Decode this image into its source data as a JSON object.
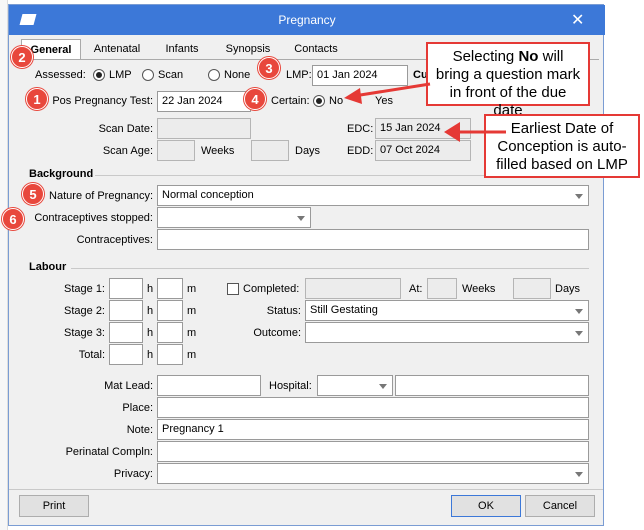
{
  "window": {
    "title": "Pregnancy"
  },
  "tabs": [
    "General",
    "Antenatal",
    "Infants",
    "Synopsis",
    "Contacts"
  ],
  "assessed": {
    "label": "Assessed:",
    "options": [
      "LMP",
      "Scan",
      "None"
    ],
    "selected": "LMP"
  },
  "lmp": {
    "label": "LMP:",
    "value": "01 Jan 2024",
    "cut_label": "Cu"
  },
  "pos_test": {
    "label": "Pos Pregnancy Test:",
    "value": "22 Jan 2024"
  },
  "certain": {
    "label": "Certain:",
    "options": [
      "No",
      "Yes"
    ],
    "selected": "No",
    "yes_fragment": "Yes"
  },
  "scan_date": {
    "label": "Scan Date:",
    "value": ""
  },
  "scan_age": {
    "label": "Scan Age:",
    "weeks_label": "Weeks",
    "days_label": "Days"
  },
  "edc": {
    "label": "EDC:",
    "value": "15 Jan 2024"
  },
  "edd": {
    "label": "EDD:",
    "value": "07 Oct 2024"
  },
  "background": {
    "heading": "Background",
    "nature_label": "Nature of Pregnancy:",
    "nature_value": "Normal conception",
    "contra_stopped_label": "Contraceptives stopped:",
    "contra_stopped_value": "",
    "contraceptives_label": "Contraceptives:",
    "contraceptives_value": ""
  },
  "labour": {
    "heading": "Labour",
    "stage1": "Stage 1:",
    "stage2": "Stage 2:",
    "stage3": "Stage 3:",
    "total": "Total:",
    "h": "h",
    "m": "m",
    "completed_label": "Completed:",
    "at_label": "At:",
    "weeks": "Weeks",
    "days": "Days",
    "status_label": "Status:",
    "status_value": "Still Gestating",
    "outcome_label": "Outcome:",
    "outcome_value": ""
  },
  "other": {
    "mat_lead_label": "Mat Lead:",
    "hospital_label": "Hospital:",
    "place_label": "Place:",
    "note_label": "Note:",
    "note_value": "Pregnancy 1",
    "perinatal_label": "Perinatal Compln:",
    "privacy_label": "Privacy:"
  },
  "buttons": {
    "print": "Print",
    "ok": "OK",
    "cancel": "Cancel"
  },
  "annotations": {
    "badges": [
      "1",
      "2",
      "3",
      "4",
      "5",
      "6"
    ],
    "callout1": "Selecting No will bring a question mark in front of the due date",
    "callout1_bold": "No",
    "callout2": "Earliest Date of Conception is auto-filled based on LMP"
  },
  "colors": {
    "titlebar": "#3c78d8",
    "accent_red": "#e53935",
    "window_bg": "#f0f0f0"
  }
}
